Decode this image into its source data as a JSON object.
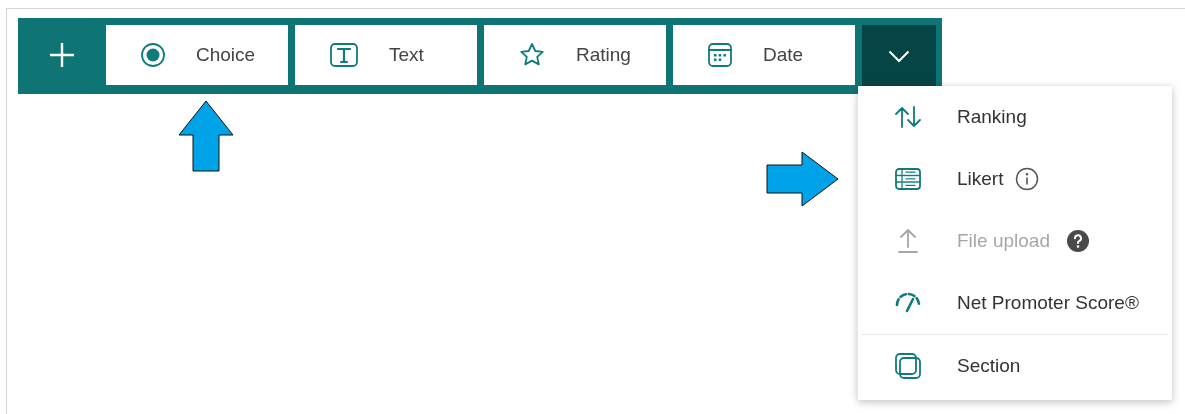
{
  "toolbar": {
    "add_button": {
      "kind": "add"
    },
    "question_types": [
      {
        "label": "Choice",
        "kind": "choice",
        "pointed_at": true
      },
      {
        "label": "Text",
        "kind": "text",
        "pointed_at": false
      },
      {
        "label": "Rating",
        "kind": "rating",
        "pointed_at": false
      },
      {
        "label": "Date",
        "kind": "date",
        "pointed_at": false
      }
    ],
    "more_button": {
      "expanded": true
    }
  },
  "menu": {
    "items": [
      {
        "label": "Ranking",
        "kind": "ranking",
        "disabled": false,
        "info_icon": false,
        "help_icon": false,
        "separator_before": false,
        "pointed_at": false
      },
      {
        "label": "Likert",
        "kind": "likert",
        "disabled": false,
        "info_icon": true,
        "help_icon": false,
        "separator_before": false,
        "pointed_at": true
      },
      {
        "label": "File upload",
        "kind": "upload",
        "disabled": true,
        "info_icon": false,
        "help_icon": true,
        "separator_before": false,
        "pointed_at": false
      },
      {
        "label": "Net Promoter Score®",
        "kind": "nps",
        "disabled": false,
        "info_icon": false,
        "help_icon": false,
        "separator_before": false,
        "pointed_at": false
      },
      {
        "label": "Section",
        "kind": "section",
        "disabled": false,
        "info_icon": false,
        "help_icon": false,
        "separator_before": true,
        "pointed_at": false
      }
    ]
  }
}
